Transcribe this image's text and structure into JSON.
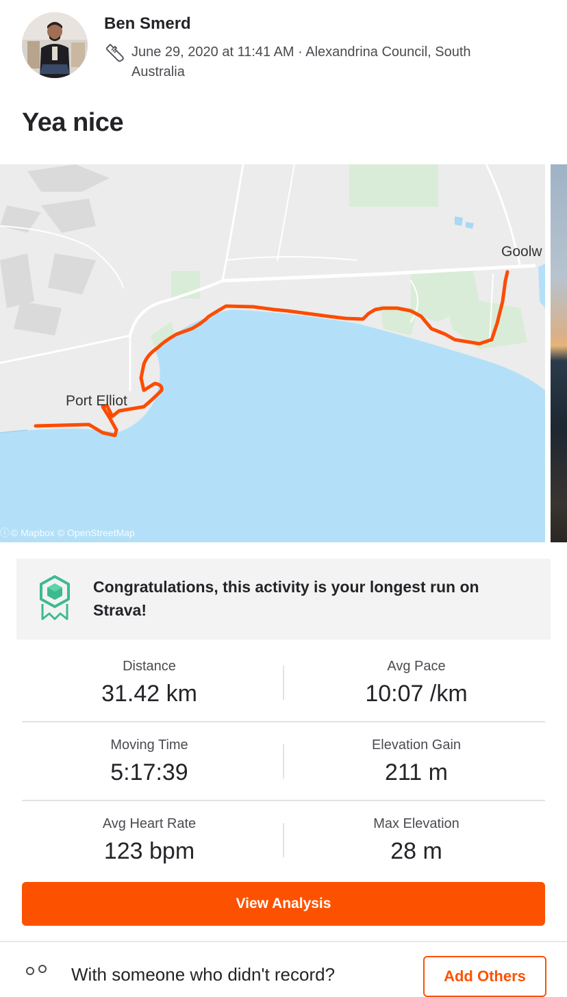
{
  "activity": {
    "athlete_name": "Ben Smerd",
    "activity_icon": "running-shoe-icon",
    "meta_text": "June 29, 2020 at 11:41 AM · Alexandrina Council, South Australia",
    "title": "Yea nice"
  },
  "map": {
    "labels": {
      "goolwa": "Goolw",
      "port_elliot": "Port Elliot"
    },
    "attribution": "© Mapbox © OpenStreetMap",
    "route_color": "#fc4c02",
    "water_color": "#b3e0f8",
    "land_color": "#ececec"
  },
  "achievement": {
    "icon": "achievement-badge-icon",
    "text": "Congratulations, this activity is your longest run on Strava!",
    "accent_color": "#3cba8f"
  },
  "stats": [
    {
      "label": "Distance",
      "value": "31.42 km"
    },
    {
      "label": "Avg Pace",
      "value": "10:07 /km"
    },
    {
      "label": "Moving Time",
      "value": "5:17:39"
    },
    {
      "label": "Elevation Gain",
      "value": "211 m"
    },
    {
      "label": "Avg Heart Rate",
      "value": "123 bpm"
    },
    {
      "label": "Max Elevation",
      "value": "28 m"
    }
  ],
  "actions": {
    "view_analysis_label": "View Analysis",
    "with_someone_text": "With someone who didn't record?",
    "add_others_label": "Add Others",
    "brand_color": "#fc5200"
  }
}
